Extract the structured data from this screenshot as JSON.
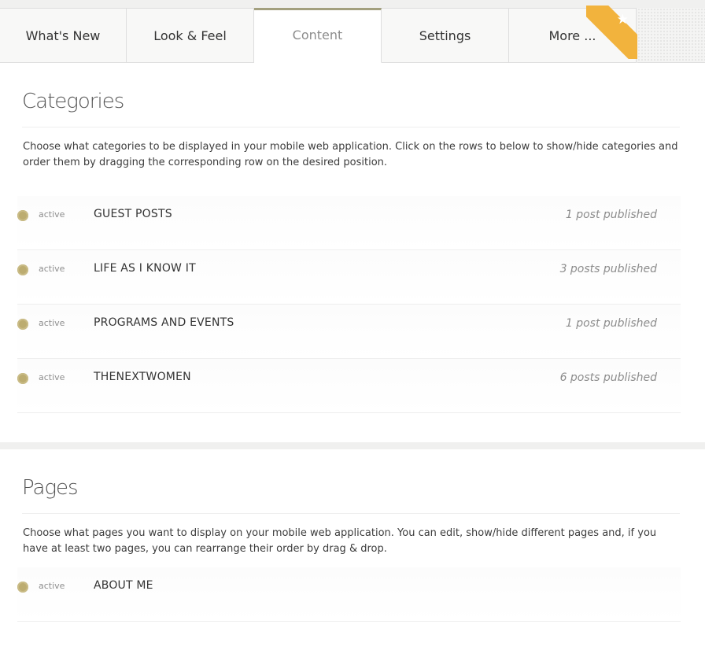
{
  "tabs": [
    {
      "label": "What's New",
      "active": false
    },
    {
      "label": "Look & Feel",
      "active": false
    },
    {
      "label": "Content",
      "active": true
    },
    {
      "label": "Settings",
      "active": false
    },
    {
      "label": "More ...",
      "active": false
    }
  ],
  "ribbon_icon": "star-icon",
  "colors": {
    "accent": "#a3a07f",
    "ribbon": "#f2b33d",
    "status_dot": "#bcac70"
  },
  "categories": {
    "title": "Categories",
    "description": "Choose what categories to be displayed in your mobile web application. Click on the rows to below to show/hide categories and order them by dragging the corresponding row on the desired position.",
    "items": [
      {
        "status": "active",
        "name": "GUEST POSTS",
        "count": "1 post published"
      },
      {
        "status": "active",
        "name": "LIFE AS I KNOW IT",
        "count": "3 posts published"
      },
      {
        "status": "active",
        "name": "PROGRAMS AND EVENTS",
        "count": "1 post published"
      },
      {
        "status": "active",
        "name": "THENEXTWOMEN",
        "count": "6 posts published"
      }
    ]
  },
  "pages": {
    "title": "Pages",
    "description": "Choose what pages you want to display on your mobile web application. You can edit, show/hide different pages and, if you have at least two pages, you can rearrange their order by drag & drop.",
    "items": [
      {
        "status": "active",
        "name": "ABOUT ME"
      }
    ]
  }
}
